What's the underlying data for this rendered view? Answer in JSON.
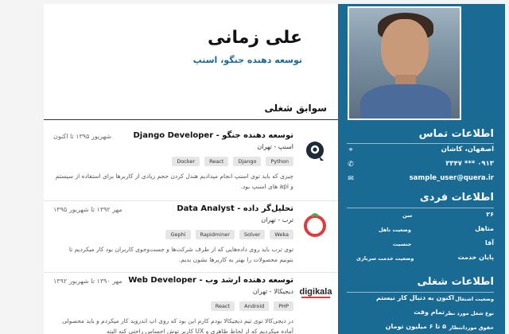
{
  "profile": {
    "name": "علی زمانی",
    "title": "توسعه دهنده جنگو، اسنپ",
    "photo_alt": "profile-photo"
  },
  "contact": {
    "heading": "اطلاعات تماس",
    "items": [
      {
        "icon": "location-pin-icon",
        "glyph": "⌖",
        "text": "اصفهان، کاشان"
      },
      {
        "icon": "phone-icon",
        "glyph": "✆",
        "text": "۰۹۱۳ *** ۳۳۴۷"
      },
      {
        "icon": "email-icon",
        "glyph": "✉",
        "text": "sample_user@quera.ir"
      }
    ]
  },
  "personal": {
    "heading": "اطلاعات فردی",
    "items": [
      {
        "key": "سن",
        "value": "۲۶"
      },
      {
        "key": "وضعیت تاهل",
        "value": "متاهل"
      },
      {
        "key": "جنسیت",
        "value": "آقا"
      },
      {
        "key": "وضعیت خدمت سربازی",
        "value": "پایان خدمت"
      }
    ]
  },
  "job_info": {
    "heading": "اطلاعات شغلی",
    "items": [
      {
        "key": "وضعیت اشتغال",
        "value": "اکنون به دنبال کار نیستم"
      },
      {
        "key": "نوع شغل مورد نظر",
        "value": "تمام وقت"
      },
      {
        "key": "حقوق موردانتظار",
        "value": "۵ تا ۶ میلیون تومان"
      }
    ]
  },
  "experience": {
    "heading": "سوابق شغلی",
    "jobs": [
      {
        "role_fa": "توسعه دهنده جنگو - ",
        "role_en": "Django Developer",
        "company": "اسنپ - تهران",
        "date": "شهریور ۱۳۹۵ تا اکنون",
        "tags": [
          "Python",
          "Django",
          "React",
          "Docker"
        ],
        "desc": "چیزی که باید توی اسنپ انجام میدادیم هندل کردن حجم زیادی از کاربرها برای استفاده از سیستم و api های اسنپ بود."
      },
      {
        "role_fa": "تحلیل‌گر داده - ",
        "role_en": "Data Analyst",
        "company": "ترب - تهران",
        "date": "مهر ۱۳۹۲ تا شهریور ۱۳۹۵",
        "tags": [
          "Weka",
          "Solver",
          "Rapidminer",
          "Gephi"
        ],
        "desc": "توی ترب باید روی داده‌هایی که از طرف شرکت‌ها و جست‌وجوی کاربران بود کار میکردیم تا بتونیم محصولات را بهتر به کاربرها نشون بدیم."
      },
      {
        "role_fa": "توسعه دهنده ارشد وب - ",
        "role_en": "Web Developer",
        "company": "دیجیکالا - تهران",
        "date": "مهر ۱۳۹۰ تا شهریور ۱۳۹۲",
        "tags": [
          "PHP",
          "Android",
          "React"
        ],
        "desc": "در دیجی‌کالا توی تیم دیجیکالا بودم کارم این بود که روی اپ اندروید کار میکردم و باید محصولی آماده میکردیم که از لحاظ ظاهری و UX کاربر توش احساس راحتی کنه البته"
      }
    ]
  },
  "colors": {
    "sidebar": "#1a6b94",
    "accent": "#1a6b94",
    "tag_bg": "#e6e6e6"
  },
  "logos": [
    "snapp-logo",
    "torob-logo",
    "digikala-logo"
  ],
  "digikala_logo_text": "digikala"
}
